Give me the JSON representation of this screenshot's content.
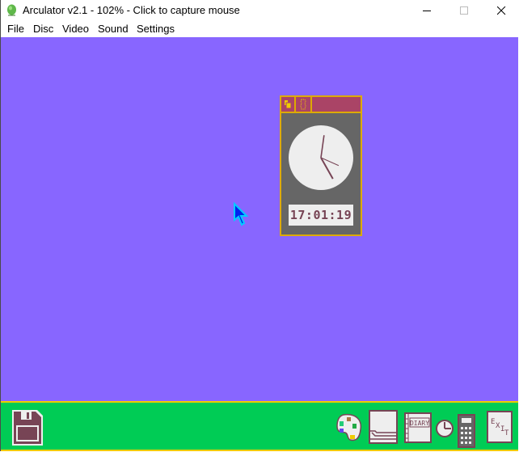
{
  "window": {
    "title": "Arculator v2.1 - 102% - Click to capture mouse",
    "controls": {
      "minimize": "minimize-icon",
      "maximize": "maximize-icon",
      "close": "close-icon"
    }
  },
  "menubar": {
    "items": [
      "File",
      "Disc",
      "Video",
      "Sound",
      "Settings"
    ]
  },
  "colors": {
    "desktop": "#8866ff",
    "iconbar": "#00cc55",
    "iconbar_border": "#eecc00",
    "clock_window_bg": "#666666",
    "clock_titlebar": "#aa4466",
    "clock_border": "#ddaa00",
    "clock_hands": "#774455"
  },
  "clock_window": {
    "titlebar_icons": [
      "back-icon",
      "toggle-size-icon"
    ],
    "digital_time": "17:01:19",
    "analog": {
      "hour": 17,
      "minute": 1,
      "second": 19
    }
  },
  "iconbar": {
    "left": [
      {
        "name": "floppy-disc-icon",
        "label": ""
      }
    ],
    "right": [
      {
        "name": "palette-icon"
      },
      {
        "name": "edit-icon"
      },
      {
        "name": "diary-icon",
        "label": "DIARY"
      },
      {
        "name": "alarm-clock-icon"
      },
      {
        "name": "calculator-icon"
      },
      {
        "name": "exit-icon",
        "label": "EXIT"
      }
    ]
  }
}
